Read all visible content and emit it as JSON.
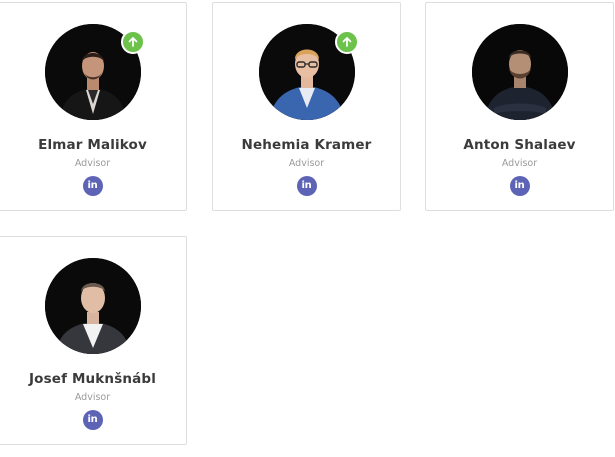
{
  "team": [
    {
      "name": "Elmar Malikov",
      "role": "Advisor",
      "social_icon": "linkedin-icon",
      "social_glyph": "in",
      "badge": "arrow-up-icon"
    },
    {
      "name": "Nehemia Kramer",
      "role": "Advisor",
      "social_icon": "linkedin-icon",
      "social_glyph": "in",
      "badge": "arrow-up-icon"
    },
    {
      "name": "Anton Shalaev",
      "role": "Advisor",
      "social_icon": "linkedin-icon",
      "social_glyph": "in"
    },
    {
      "name": "Josef Muknšnábl",
      "role": "Advisor",
      "social_icon": "linkedin-icon",
      "social_glyph": "in"
    }
  ],
  "colors": {
    "badge": "#6cc24a",
    "linkedin": "#5d64b5",
    "name": "#3b3b3b",
    "role": "#9a9a9a",
    "card_border": "#dedede"
  }
}
